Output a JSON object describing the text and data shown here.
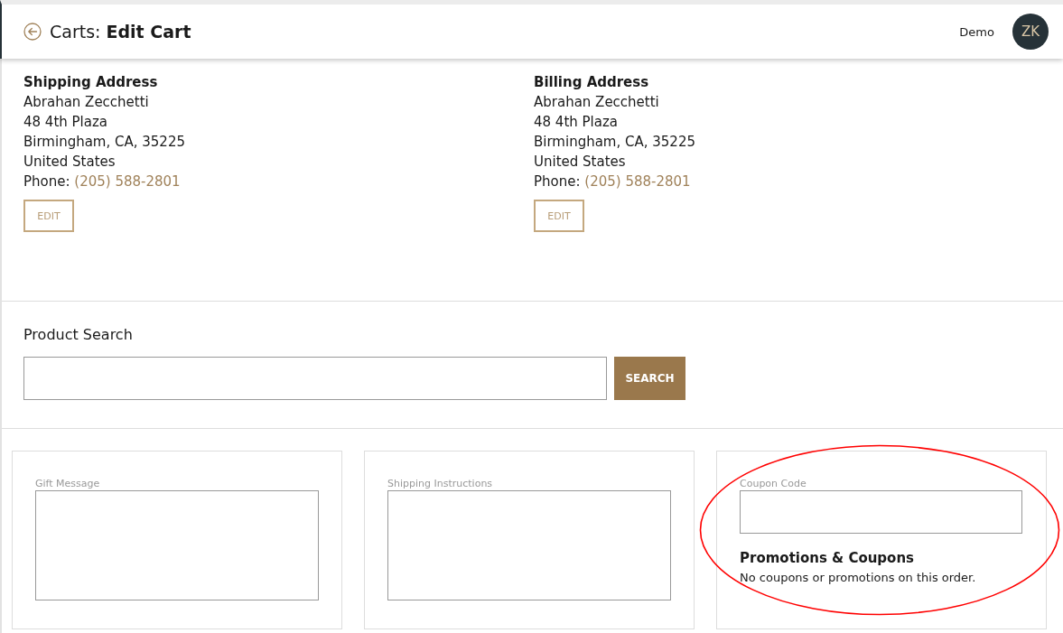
{
  "header": {
    "title": "Carts: **Edit Cart**",
    "user_name": "Demo",
    "avatar_initials": "ZK"
  },
  "addresses": [
    {
      "heading": "Shipping Address",
      "lines": [
        "Abrahan Zecchetti",
        "48 4th Plaza",
        "Birmingham, CA, 35225",
        "United States"
      ],
      "phone_label": "Phone:",
      "phone": "(205) 588-2801",
      "button": "EDIT"
    },
    {
      "heading": "Billing Address",
      "lines": [
        "Abrahan Zecchetti",
        "48 4th Plaza",
        "Birmingham, CA, 35225",
        "United States"
      ],
      "phone_label": "Phone:",
      "phone": "(205) 588-2801",
      "button": "EDIT"
    }
  ],
  "product_search": {
    "label": "Product Search",
    "button": "SEARCH"
  },
  "panels": [
    {
      "kind": "textarea",
      "label": "Gift Message",
      "highlighted": false
    },
    {
      "kind": "textarea",
      "label": "Shipping Instructions",
      "highlighted": false
    },
    {
      "kind": "coupon",
      "label": "Coupon Code",
      "heading": "Promotions & Coupons",
      "text": "No coupons or promotions on this order.",
      "highlighted": true
    }
  ]
}
